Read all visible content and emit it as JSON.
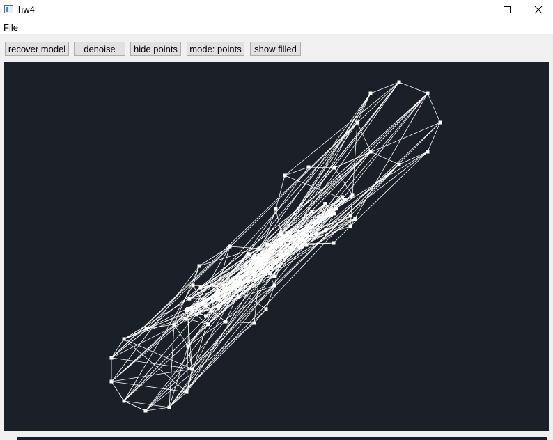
{
  "window": {
    "title": "hw4",
    "icon": "app-window-icon",
    "controls": [
      "minimize-icon",
      "maximize-icon",
      "close-icon"
    ]
  },
  "menu": {
    "file": "File"
  },
  "toolbar": {
    "recover_model": "recover model",
    "denoise": "denoise",
    "hide_points": "hide points",
    "mode": "mode: points",
    "show_filled": "show filled"
  },
  "canvas": {
    "background": "#1b1f27",
    "stroke": "#ffffff"
  }
}
